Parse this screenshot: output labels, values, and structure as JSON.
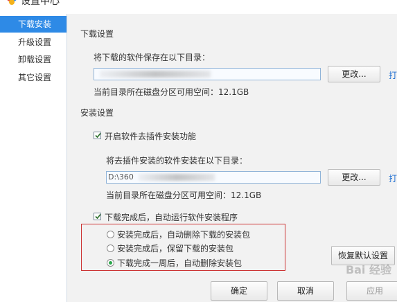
{
  "window": {
    "title": "设置中心"
  },
  "sidebar": {
    "items": [
      {
        "label": "下载安装",
        "active": true
      },
      {
        "label": "升级设置",
        "active": false
      },
      {
        "label": "卸载设置",
        "active": false
      },
      {
        "label": "其它设置",
        "active": false
      }
    ]
  },
  "download": {
    "section_title": "下载设置",
    "save_dir_label": "将下载的软件保存在以下目录：",
    "path_value": "",
    "change_label": "更改...",
    "open_label": "打",
    "space_text": "当前目录所在磁盘分区可用空间：12.1GB"
  },
  "install": {
    "section_title": "安装设置",
    "plugin_checkbox_label": "开启软件去插件安装功能",
    "plugin_checked": true,
    "install_dir_label": "将去插件安装的软件安装在以下目录：",
    "path_value": "D:\\360",
    "change_label": "更改...",
    "open_label": "打",
    "space_text": "当前目录所在磁盘分区可用空间：12.1GB",
    "auto_run_label": "下载完成后，自动运行软件安装程序",
    "auto_run_checked": true,
    "options": [
      {
        "label": "安装完成后，自动删除下载的安装包",
        "selected": false
      },
      {
        "label": "安装完成后，保留下载的安装包",
        "selected": false
      },
      {
        "label": "下载完成一周后，自动删除安装包",
        "selected": true
      }
    ],
    "restore_label": "恢复默认设置"
  },
  "footer": {
    "ok_label": "确定",
    "cancel_label": "取消",
    "apply_label": "应用"
  },
  "watermark": {
    "text": "Bai 经验"
  },
  "colors": {
    "accent": "#2e8ae6",
    "radio_on": "#2aa54a",
    "highlight_box": "#cc3333"
  }
}
